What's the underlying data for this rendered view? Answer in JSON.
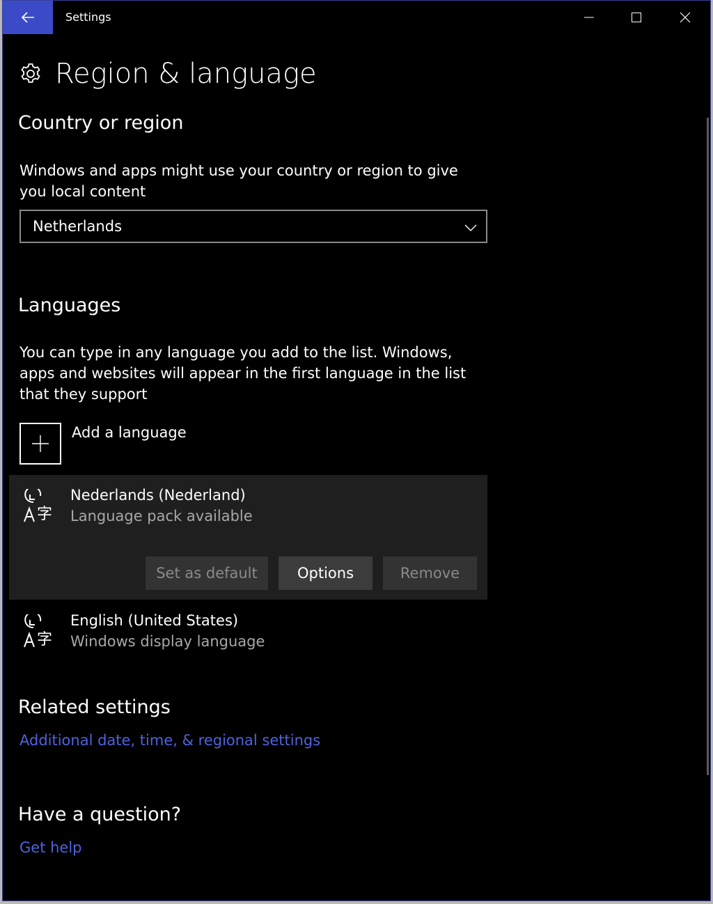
{
  "window": {
    "title": "Settings",
    "controls": {
      "minimize": "minimize-icon",
      "maximize": "maximize-icon",
      "close": "close-icon"
    }
  },
  "header": {
    "title": "Region & language",
    "icon": "gear-icon"
  },
  "country": {
    "heading": "Country or region",
    "description": "Windows and apps might use your country or region to give you local content",
    "selected": "Netherlands"
  },
  "languages": {
    "heading": "Languages",
    "description": "You can type in any language you add to the list. Windows, apps and websites will appear in the first language in the list that they support",
    "add_label": "Add a language",
    "items": [
      {
        "name": "Nederlands (Nederland)",
        "status": "Language pack available"
      },
      {
        "name": "English (United States)",
        "status": "Windows display language"
      }
    ],
    "buttons": {
      "set_default": "Set as default",
      "options": "Options",
      "remove": "Remove"
    }
  },
  "related": {
    "heading": "Related settings",
    "link": "Additional date, time, & regional settings"
  },
  "question": {
    "heading": "Have a question?",
    "link": "Get help"
  },
  "colors": {
    "accent": "#3b4bc8",
    "link": "#4e63de",
    "background": "#000000",
    "selected_row": "#1f1f1f"
  }
}
